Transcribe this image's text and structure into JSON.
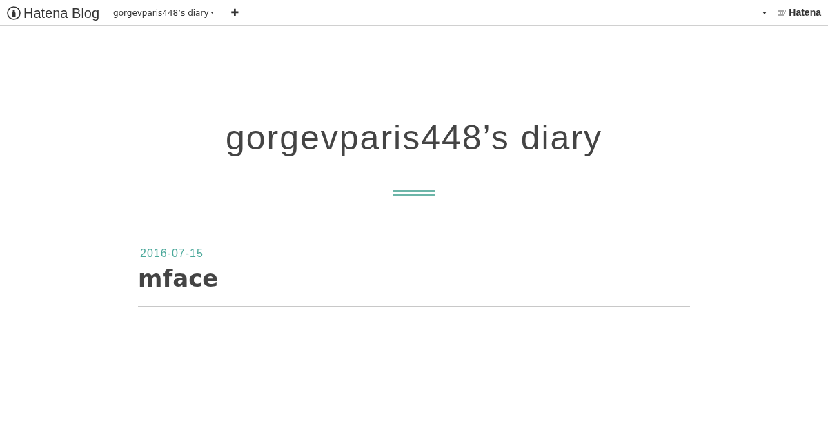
{
  "navbar": {
    "logo": "Hatena Blog",
    "blog_menu": "gorgevparis448’s diary",
    "add_button": "✚",
    "hatena_logo": "Hatena"
  },
  "blog": {
    "title": "gorgevparis448’s diary"
  },
  "entries": [
    {
      "date": "2016-07-15",
      "title": "mface"
    }
  ]
}
